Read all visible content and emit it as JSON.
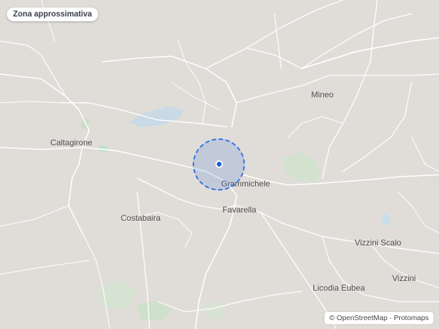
{
  "header": {
    "zone_label": "Zona approssimativa"
  },
  "places": [
    {
      "name": "Mineo"
    },
    {
      "name": "Caltagirone"
    },
    {
      "name": "Grammichele"
    },
    {
      "name": "Favarella"
    },
    {
      "name": "Costabaira"
    },
    {
      "name": "Vizzini Scalo"
    },
    {
      "name": "Vizzini"
    },
    {
      "name": "Licodia Eubea"
    }
  ],
  "attribution": {
    "prefix": "©",
    "osm": "OpenStreetMap",
    "separator": "·",
    "protomaps": "Protomaps"
  },
  "colors": {
    "land": "#e0ddd9",
    "road": "#ffffff",
    "water": "#c5d8e8",
    "park": "#cfe4cf",
    "zone_fill": "#2f6fe0",
    "marker": "#1a5fd6"
  },
  "icons": {
    "location_marker": "location-dot-icon"
  }
}
